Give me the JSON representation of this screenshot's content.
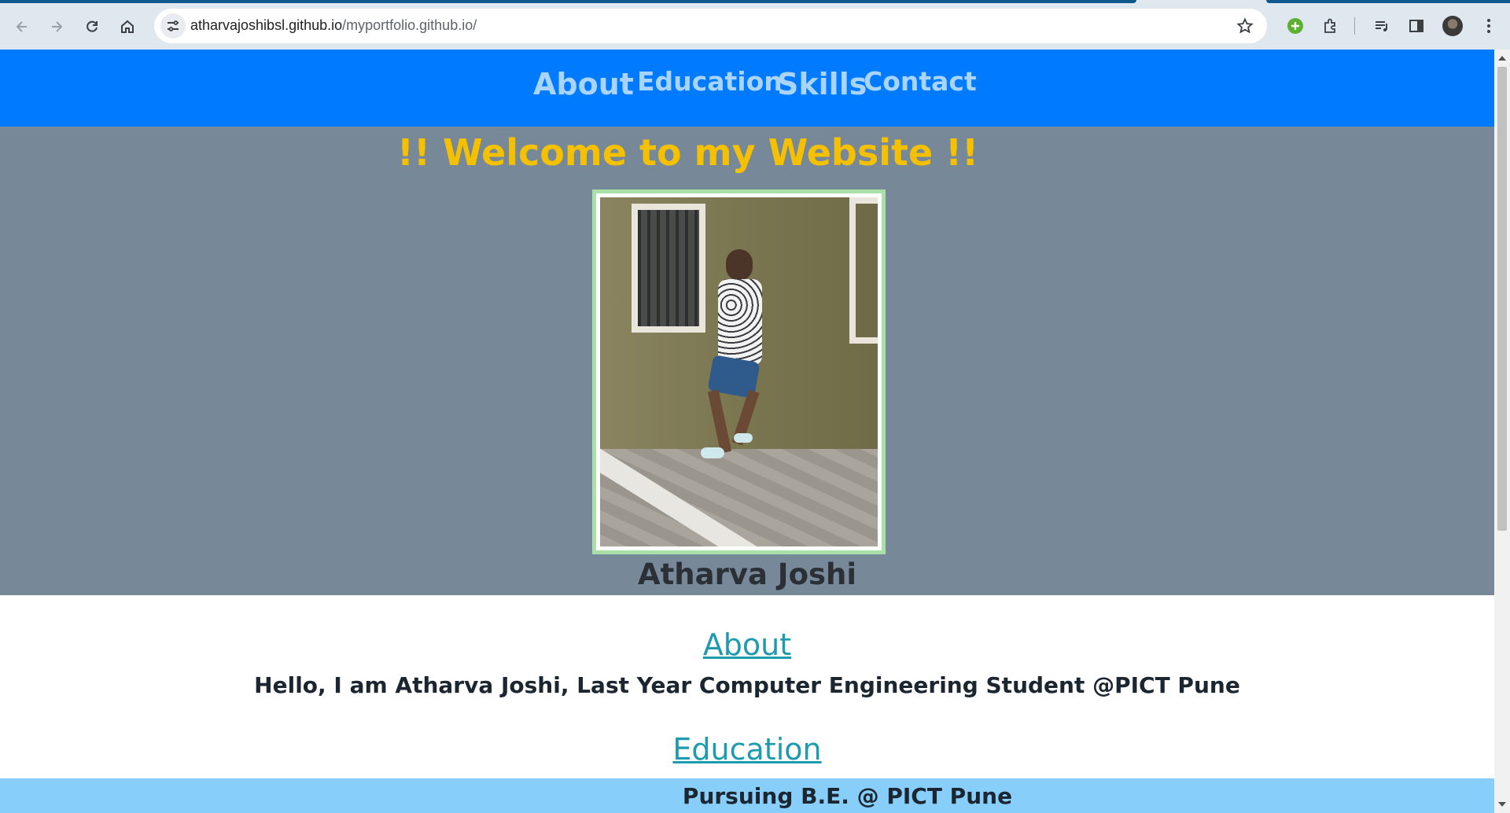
{
  "browser": {
    "url_host": "atharvajoshibsl.github.io",
    "url_path": "/myportfolio.github.io/"
  },
  "site": {
    "nav": {
      "items": [
        "About",
        "Education",
        "Skills",
        "Contact"
      ]
    },
    "hero": {
      "welcome": "!! Welcome to my Website !!",
      "name": "Atharva Joshi"
    },
    "about": {
      "title": "About",
      "text": "Hello, I am Atharva Joshi, Last Year Computer Engineering Student @PICT Pune"
    },
    "education": {
      "title": "Education",
      "item": "Pursuing B.E. @ PICT Pune"
    }
  },
  "colors": {
    "nav_bg": "#007bff",
    "nav_link": "#a8d4ff",
    "hero_bg": "#778899",
    "welcome": "#f5c000",
    "section_title": "#1f9bb0",
    "edu_band": "#87cefa"
  }
}
